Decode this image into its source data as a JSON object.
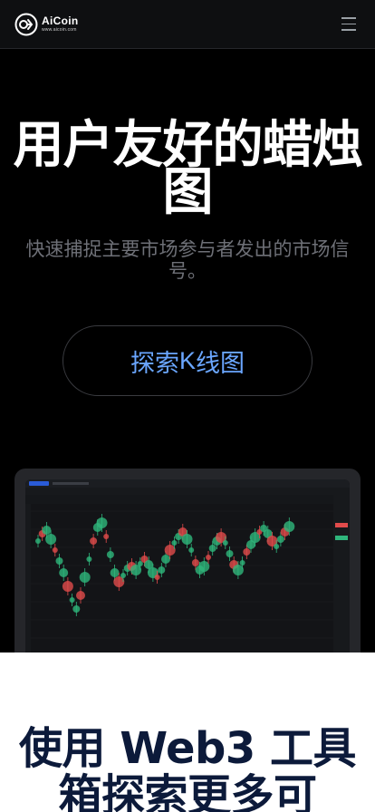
{
  "nav": {
    "logo_name": "AiCoin",
    "logo_url": "www.aicoin.com",
    "menu_icon": "hamburger-menu-icon"
  },
  "hero": {
    "title": "用户友好的蜡烛图",
    "subtitle": "快速捕捉主要市场参与者发出的市场信号。",
    "cta_prefix": "探索",
    "cta_accent": "K",
    "cta_suffix": "线图"
  },
  "section2": {
    "title": "使用 Web3 工具箱探索更多可"
  },
  "colors": {
    "background": "#000000",
    "cta_text": "#6aa6ff",
    "title_dark": "#0c1a3a",
    "up_green": "#2fb67c",
    "down_red": "#e14b4b"
  }
}
